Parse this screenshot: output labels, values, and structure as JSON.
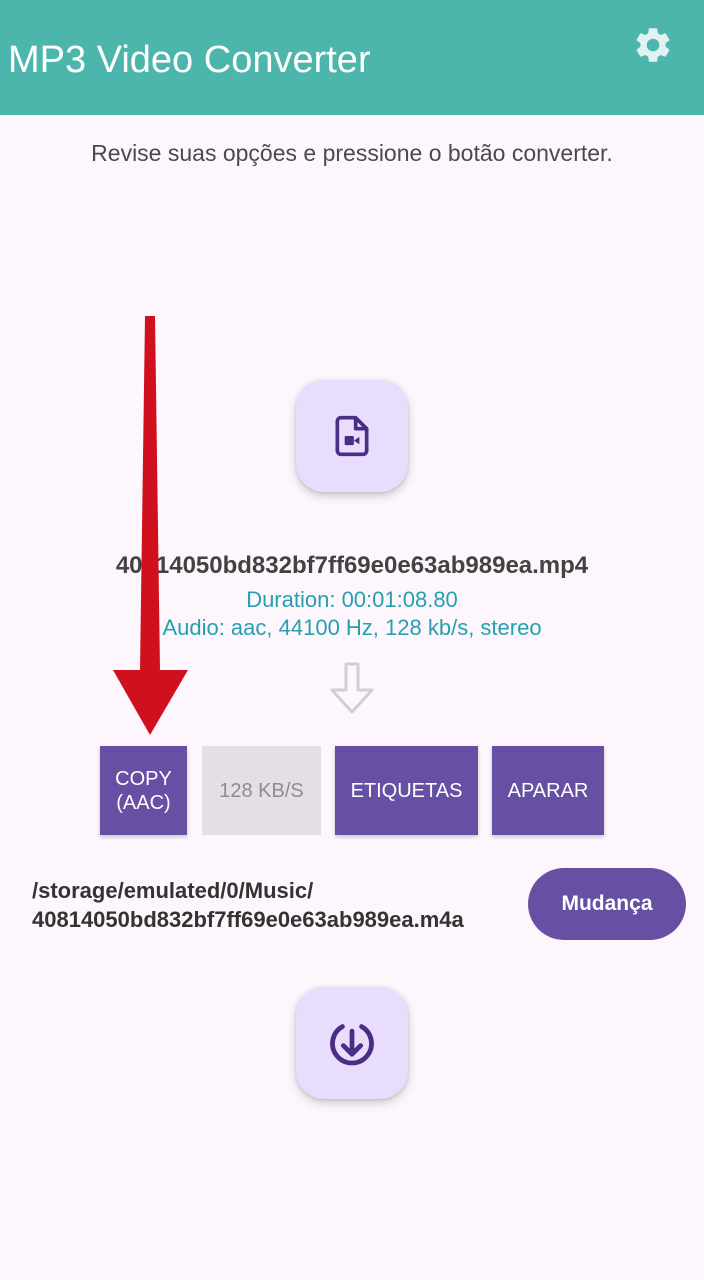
{
  "app_bar": {
    "title": "MP3 Video Converter",
    "settings_icon": "gear-icon",
    "color": "#4db6ac"
  },
  "main": {
    "instruction": "Revise suas opções e pressione o botão converter.",
    "file": {
      "icon": "video-file-icon",
      "name": "40814050bd832bf7ff69e0e63ab989ea.mp4",
      "duration": "Duration: 00:01:08.80",
      "audio": "Audio: aac, 44100 Hz, 128 kb/s,  stereo"
    },
    "options": {
      "copy_line1": "COPY",
      "copy_line2": "(AAC)",
      "bitrate": "128 KB/S",
      "tags": "ETIQUETAS",
      "trim": "APARAR"
    },
    "output": {
      "path_line1": "/storage/emulated/0/Music/",
      "path_line2": "40814050bd832bf7ff69e0e63ab989ea.m4a",
      "change_label": "Mudança"
    },
    "convert_icon": "download-circle-icon"
  },
  "colors": {
    "accent": "#6750a4",
    "fab_bg": "#e8ddfd",
    "info_text": "#26a0b0",
    "annotation_arrow": "#d0101c"
  }
}
